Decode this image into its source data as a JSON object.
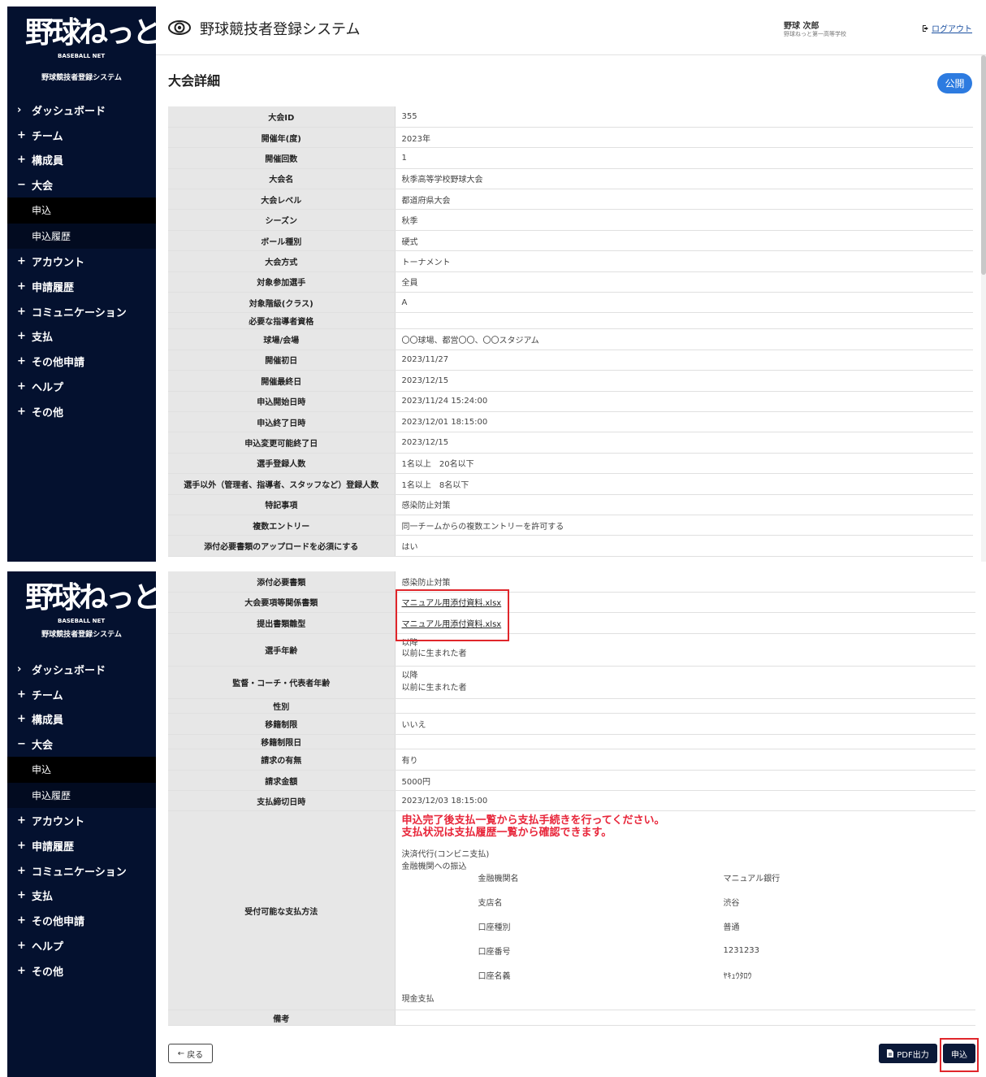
{
  "sidebar": {
    "logo_text": "野球ねっと",
    "logo_sub": "BASEBALL NET",
    "system_label": "野球競技者登録システム",
    "items": [
      {
        "symbol": "›",
        "label": "ダッシュボード"
      },
      {
        "symbol": "+",
        "label": "チーム"
      },
      {
        "symbol": "+",
        "label": "構成員"
      },
      {
        "symbol": "−",
        "label": "大会"
      }
    ],
    "subitems": [
      {
        "label": "申込",
        "active": true
      },
      {
        "label": "申込履歴",
        "active": false
      }
    ],
    "items_after": [
      {
        "symbol": "+",
        "label": "アカウント"
      },
      {
        "symbol": "+",
        "label": "申請履歴"
      },
      {
        "symbol": "+",
        "label": "コミュニケーション"
      },
      {
        "symbol": "+",
        "label": "支払"
      },
      {
        "symbol": "+",
        "label": "その他申請"
      },
      {
        "symbol": "+",
        "label": "ヘルプ"
      },
      {
        "symbol": "+",
        "label": "その他"
      }
    ]
  },
  "header": {
    "title": "野球競技者登録システム",
    "user_name": "野球 次郎",
    "user_org": "野球ねっと第一高等学校",
    "logout_label": "ログアウト"
  },
  "page": {
    "title": "大会詳細",
    "status_badge": "公開"
  },
  "details_top": [
    {
      "label": "大会ID",
      "value": "355"
    },
    {
      "label": "開催年(度)",
      "value": "2023年"
    },
    {
      "label": "開催回数",
      "value": "1"
    },
    {
      "label": "大会名",
      "value": "秋季高等学校野球大会"
    },
    {
      "label": "大会レベル",
      "value": "都道府県大会"
    },
    {
      "label": "シーズン",
      "value": "秋季"
    },
    {
      "label": "ボール種別",
      "value": "硬式"
    },
    {
      "label": "大会方式",
      "value": "トーナメント"
    },
    {
      "label": "対象参加選手",
      "value": "全員"
    },
    {
      "label": "対象階級(クラス)",
      "value": "A"
    },
    {
      "label": "必要な指導者資格",
      "value": ""
    },
    {
      "label": "球場/会場",
      "value": "〇〇球場、都営〇〇、〇〇スタジアム"
    },
    {
      "label": "開催初日",
      "value": "2023/11/27"
    },
    {
      "label": "開催最終日",
      "value": "2023/12/15"
    },
    {
      "label": "申込開始日時",
      "value": "2023/11/24 15:24:00"
    },
    {
      "label": "申込終了日時",
      "value": "2023/12/01 18:15:00"
    },
    {
      "label": "申込変更可能終了日",
      "value": "2023/12/15"
    },
    {
      "label": "選手登録人数",
      "value": "1名以上　20名以下"
    },
    {
      "label": "選手以外（管理者、指導者、スタッフなど）登録人数",
      "value": "1名以上　8名以下"
    },
    {
      "label": "特記事項",
      "value": "感染防止対策"
    },
    {
      "label": "複数エントリー",
      "value": "同一チームからの複数エントリーを許可する"
    },
    {
      "label": "添付必要書類のアップロードを必須にする",
      "value": "はい"
    }
  ],
  "details_bottom": {
    "attach_docs": {
      "label": "添付必要書類",
      "value": "感染防止対策"
    },
    "guideline_docs": {
      "label": "大会要項等関係書類",
      "value": "マニュアル用添付資料.xlsx"
    },
    "template_docs": {
      "label": "提出書類雛型",
      "value": "マニュアル用添付資料.xlsx"
    },
    "player_age": {
      "label": "選手年齢",
      "line1": "以降",
      "line2": "以前に生まれた者"
    },
    "coach_age": {
      "label": "監督・コーチ・代表者年齢",
      "line1": "以降",
      "line2": "以前に生まれた者"
    },
    "gender": {
      "label": "性別",
      "value": ""
    },
    "transfer_limit": {
      "label": "移籍制限",
      "value": "いいえ"
    },
    "transfer_date": {
      "label": "移籍制限日",
      "value": ""
    },
    "billing": {
      "label": "請求の有無",
      "value": "有り"
    },
    "amount": {
      "label": "請求金額",
      "value": "5000円"
    },
    "pay_deadline": {
      "label": "支払締切日時",
      "value": "2023/12/03 18:15:00"
    },
    "payment": {
      "label": "受付可能な支払方法",
      "note1": "申込完了後支払一覧から支払手続きを行ってください。",
      "note2": "支払状況は支払履歴一覧から確認できます。",
      "method1": "決済代行(コンビニ支払)",
      "method2": "金融機関への振込",
      "bank_rows": [
        {
          "k": "金融機関名",
          "v": "マニュアル銀行"
        },
        {
          "k": "支店名",
          "v": "渋谷"
        },
        {
          "k": "口座種別",
          "v": "普通"
        },
        {
          "k": "口座番号",
          "v": "1231233"
        },
        {
          "k": "口座名義",
          "v": "ﾔｷｭｳﾀﾛｳ"
        }
      ],
      "method3": "現金支払"
    },
    "remarks": {
      "label": "備考",
      "value": ""
    }
  },
  "buttons": {
    "back": "戻る",
    "pdf": "PDF出力",
    "apply": "申込"
  },
  "colors": {
    "sidebar_bg": "#04112f",
    "badge": "#2d7be0",
    "highlight": "#e0262b",
    "note_red": "#e8263a",
    "button_dark": "#0b1938"
  }
}
